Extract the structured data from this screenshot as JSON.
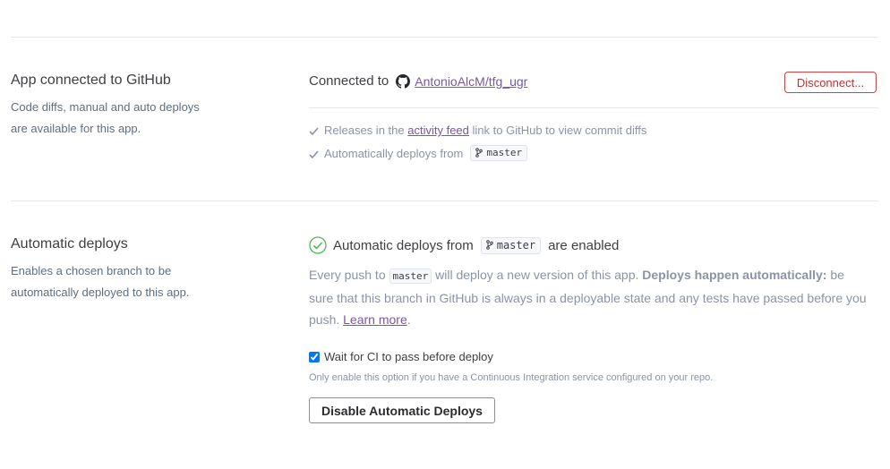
{
  "github": {
    "title": "App connected to GitHub",
    "description": "Code diffs, manual and auto deploys are available for this app.",
    "connected_prefix": "Connected to",
    "repo": "AntonioAlcM/tfg_ugr",
    "disconnect_label": "Disconnect...",
    "release_prefix": "Releases in the",
    "activity_feed": "activity feed",
    "release_suffix": "link to GitHub to view commit diffs",
    "auto_deploy_prefix": "Automatically deploys from",
    "branch": "master",
    "icons": {
      "github": "github-icon",
      "branch": "git-branch-icon",
      "check": "check-icon"
    }
  },
  "auto_deploys": {
    "title": "Automatic deploys",
    "description": "Enables a chosen branch to be automatically deployed to this app.",
    "status_prefix": "Automatic deploys from",
    "status_branch": "master",
    "status_suffix": "are enabled",
    "info_prefix": "Every push to",
    "info_branch": "master",
    "info_mid": "will deploy a new version of this app.",
    "info_bold": "Deploys happen automatically:",
    "info_rest": "be sure that this branch in GitHub is always in a deployable state and any tests have passed before you push.",
    "learn_more": "Learn more",
    "info_end": ".",
    "ci_label": "Wait for CI to pass before deploy",
    "ci_checked": true,
    "ci_hint": "Only enable this option if you have a Continuous Integration service configured on your repo.",
    "disable_label": "Disable Automatic Deploys",
    "colors": {
      "success": "#4fb856",
      "link": "#79589f",
      "danger": "#d64242"
    }
  }
}
